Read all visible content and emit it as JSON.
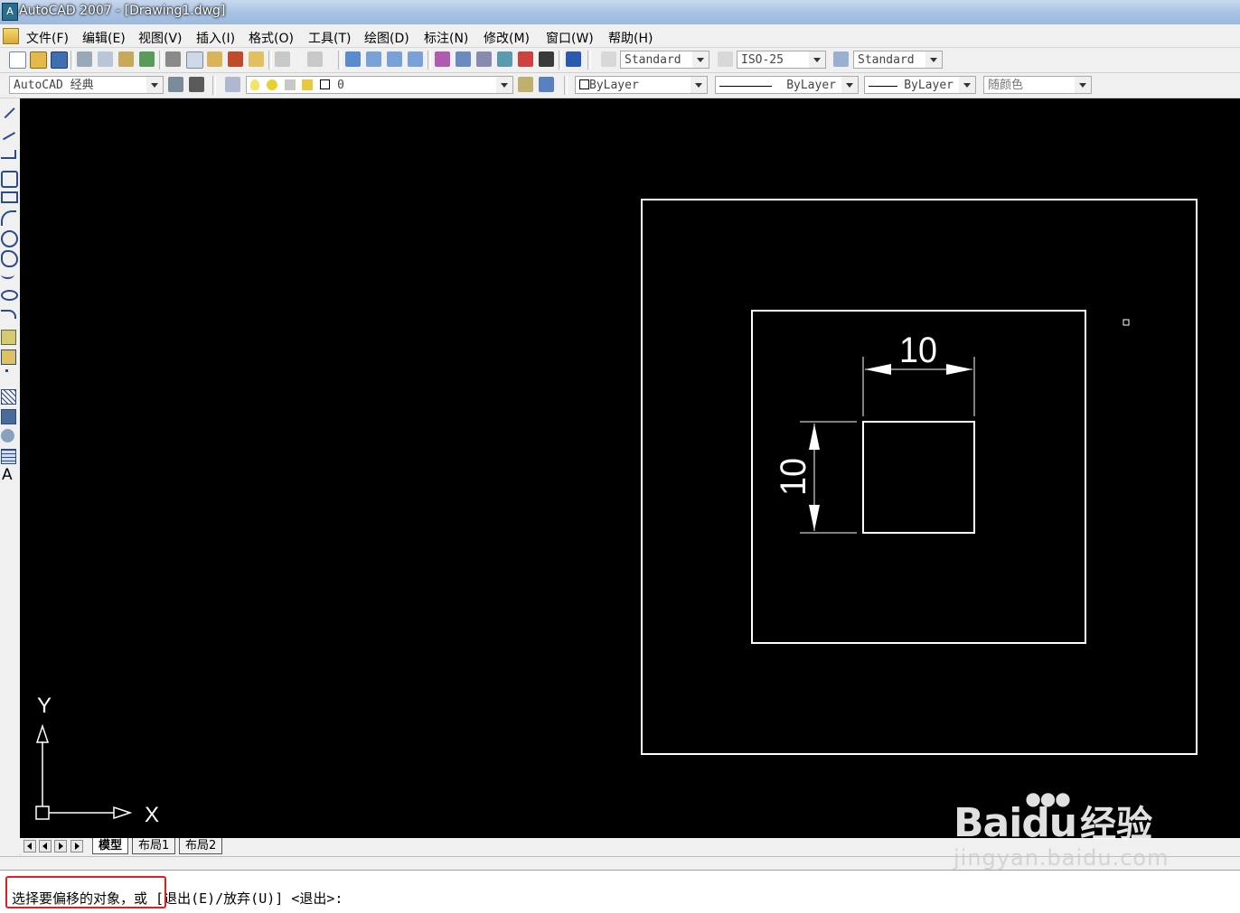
{
  "titlebar": {
    "title": "AutoCAD 2007 - [Drawing1.dwg]"
  },
  "menubar": {
    "items": [
      "文件(F)",
      "编辑(E)",
      "视图(V)",
      "插入(I)",
      "格式(O)",
      "工具(T)",
      "绘图(D)",
      "标注(N)",
      "修改(M)",
      "窗口(W)",
      "帮助(H)"
    ]
  },
  "toolbar1": {
    "text_style": "Standard",
    "dim_style": "ISO-25",
    "table_style": "Standard"
  },
  "toolbar2": {
    "workspace": "AutoCAD 经典",
    "layer": "0",
    "color": "ByLayer",
    "linetype": "ByLayer",
    "lineweight": "ByLayer",
    "plotstyle": "随颜色"
  },
  "left_toolbar": {
    "text_tool_label": "A"
  },
  "drawing": {
    "dim_horizontal": "10",
    "dim_vertical": "10",
    "ucs_x": "X",
    "ucs_y": "Y"
  },
  "tabs": {
    "model": "模型",
    "layout1": "布局1",
    "layout2": "布局2"
  },
  "command": {
    "prompt": "选择要偏移的对象，或 [退出(E)/放弃(U)] <退出>:"
  },
  "watermark": {
    "brand": "Bai",
    "brand_paw": "du",
    "brand_cn": "经验",
    "url": "jingyan.baidu.com"
  },
  "colors": {
    "canvas_bg": "#000000",
    "highlight": "#e02020",
    "titlebar": "#a9c3e3"
  }
}
